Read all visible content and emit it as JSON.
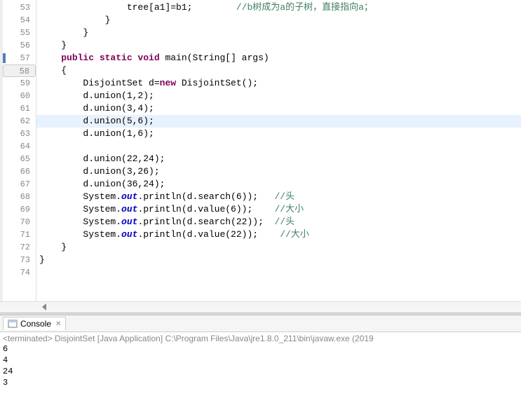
{
  "editor": {
    "lines": [
      {
        "num": "53",
        "marker": false,
        "highlight": false,
        "tokens": [
          {
            "cls": "normal",
            "t": "                tree[a1]=b1;        "
          },
          {
            "cls": "comment",
            "t": "//b树成为a的子树，直接指向a；"
          }
        ]
      },
      {
        "num": "54",
        "marker": false,
        "highlight": false,
        "tokens": [
          {
            "cls": "normal",
            "t": "            }"
          }
        ]
      },
      {
        "num": "55",
        "marker": false,
        "highlight": false,
        "tokens": [
          {
            "cls": "normal",
            "t": "        }"
          }
        ]
      },
      {
        "num": "56",
        "marker": false,
        "highlight": false,
        "tokens": [
          {
            "cls": "normal",
            "t": "    }"
          }
        ]
      },
      {
        "num": "57",
        "marker": true,
        "highlight": false,
        "tokens": [
          {
            "cls": "normal",
            "t": "    "
          },
          {
            "cls": "kw-purple",
            "t": "public static void"
          },
          {
            "cls": "normal",
            "t": " main(String[] args)"
          }
        ]
      },
      {
        "num": "58",
        "marker": false,
        "highlight": false,
        "boxed": true,
        "tokens": [
          {
            "cls": "normal",
            "t": "    {"
          }
        ]
      },
      {
        "num": "59",
        "marker": false,
        "highlight": false,
        "tokens": [
          {
            "cls": "normal",
            "t": "        DisjointSet d="
          },
          {
            "cls": "kw-purple",
            "t": "new"
          },
          {
            "cls": "normal",
            "t": " DisjointSet();"
          }
        ]
      },
      {
        "num": "60",
        "marker": false,
        "highlight": false,
        "tokens": [
          {
            "cls": "normal",
            "t": "        d.union(1,2);"
          }
        ]
      },
      {
        "num": "61",
        "marker": false,
        "highlight": false,
        "tokens": [
          {
            "cls": "normal",
            "t": "        d.union(3,4);"
          }
        ]
      },
      {
        "num": "62",
        "marker": false,
        "highlight": true,
        "tokens": [
          {
            "cls": "normal",
            "t": "        d.union(5,6);"
          }
        ]
      },
      {
        "num": "63",
        "marker": false,
        "highlight": false,
        "tokens": [
          {
            "cls": "normal",
            "t": "        d.union(1,6);"
          }
        ]
      },
      {
        "num": "64",
        "marker": false,
        "highlight": false,
        "tokens": []
      },
      {
        "num": "65",
        "marker": false,
        "highlight": false,
        "tokens": [
          {
            "cls": "normal",
            "t": "        d.union(22,24);"
          }
        ]
      },
      {
        "num": "66",
        "marker": false,
        "highlight": false,
        "tokens": [
          {
            "cls": "normal",
            "t": "        d.union(3,26);"
          }
        ]
      },
      {
        "num": "67",
        "marker": false,
        "highlight": false,
        "tokens": [
          {
            "cls": "normal",
            "t": "        d.union(36,24);"
          }
        ]
      },
      {
        "num": "68",
        "marker": false,
        "highlight": false,
        "tokens": [
          {
            "cls": "normal",
            "t": "        System."
          },
          {
            "cls": "kw-blue",
            "t": "out"
          },
          {
            "cls": "normal",
            "t": ".println(d.search(6));   "
          },
          {
            "cls": "comment",
            "t": "//头"
          }
        ]
      },
      {
        "num": "69",
        "marker": false,
        "highlight": false,
        "tokens": [
          {
            "cls": "normal",
            "t": "        System."
          },
          {
            "cls": "kw-blue",
            "t": "out"
          },
          {
            "cls": "normal",
            "t": ".println(d.value(6));    "
          },
          {
            "cls": "comment",
            "t": "//大小"
          }
        ]
      },
      {
        "num": "70",
        "marker": false,
        "highlight": false,
        "tokens": [
          {
            "cls": "normal",
            "t": "        System."
          },
          {
            "cls": "kw-blue",
            "t": "out"
          },
          {
            "cls": "normal",
            "t": ".println(d.search(22));  "
          },
          {
            "cls": "comment",
            "t": "//头"
          }
        ]
      },
      {
        "num": "71",
        "marker": false,
        "highlight": false,
        "tokens": [
          {
            "cls": "normal",
            "t": "        System."
          },
          {
            "cls": "kw-blue",
            "t": "out"
          },
          {
            "cls": "normal",
            "t": ".println(d.value(22));    "
          },
          {
            "cls": "comment",
            "t": "//大小"
          }
        ]
      },
      {
        "num": "72",
        "marker": false,
        "highlight": false,
        "tokens": [
          {
            "cls": "normal",
            "t": "    }"
          }
        ]
      },
      {
        "num": "73",
        "marker": false,
        "highlight": false,
        "tokens": [
          {
            "cls": "normal",
            "t": "}"
          }
        ]
      },
      {
        "num": "74",
        "marker": false,
        "highlight": false,
        "tokens": []
      }
    ]
  },
  "console": {
    "tab_label": "Console",
    "close_glyph": "✕",
    "header": "<terminated> DisjointSet [Java Application] C:\\Program Files\\Java\\jre1.8.0_211\\bin\\javaw.exe (2019",
    "output": [
      "6",
      "4",
      "24",
      "3"
    ]
  }
}
